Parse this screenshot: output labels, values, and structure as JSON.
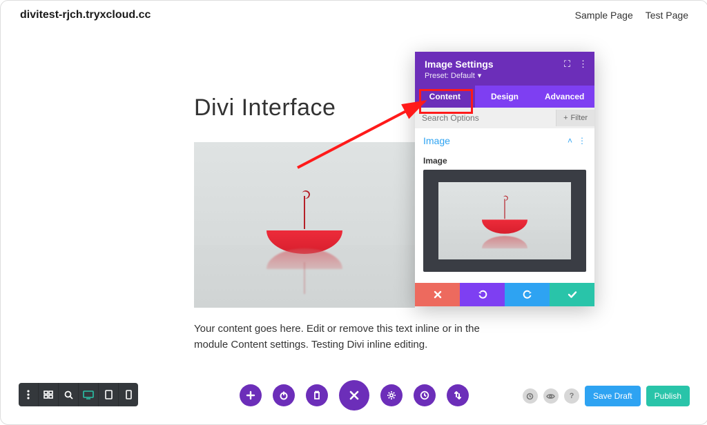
{
  "site_address": "divitest-rjch.tryxcloud.cc",
  "nav": {
    "sample": "Sample Page",
    "test": "Test Page"
  },
  "page": {
    "heading": "Divi Interface",
    "body": "Your content goes here. Edit or remove this text inline or in the module Content settings. Testing Divi inline editing."
  },
  "panel": {
    "title": "Image Settings",
    "preset_label": "Preset: Default",
    "tabs": {
      "content": "Content",
      "design": "Design",
      "advanced": "Advanced"
    },
    "active_tab": "content",
    "search_placeholder": "Search Options",
    "filter_label": "Filter",
    "section_title": "Image",
    "field_label": "Image"
  },
  "bottom": {
    "save_draft": "Save Draft",
    "publish": "Publish"
  }
}
